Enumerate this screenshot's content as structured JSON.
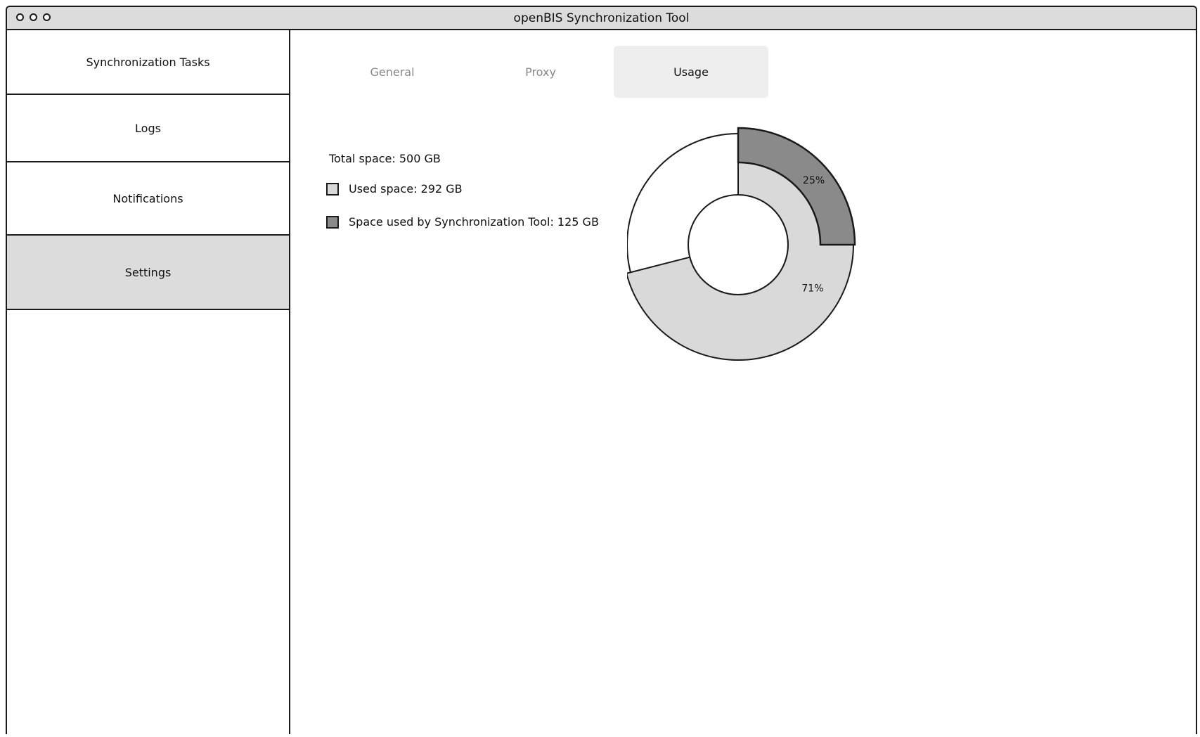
{
  "window": {
    "title": "openBIS Synchronization Tool"
  },
  "sidebar": {
    "items": [
      {
        "label": "Synchronization Tasks",
        "active": false
      },
      {
        "label": "Logs",
        "active": false
      },
      {
        "label": "Notifications",
        "active": false
      },
      {
        "label": "Settings",
        "active": true
      }
    ]
  },
  "tabs": [
    {
      "label": "General",
      "active": false
    },
    {
      "label": "Proxy",
      "active": false
    },
    {
      "label": "Usage",
      "active": true
    }
  ],
  "usage": {
    "total_label": "Total space: 500 GB",
    "used_label": "Used space: 292 GB",
    "tool_label": "Space used by Synchronization Tool: 125 GB"
  },
  "colors": {
    "used": "#d9d9d9",
    "tool": "#8a8a8a",
    "free": "#ffffff",
    "active_bg": "#dcdcdc",
    "stroke": "#1a1a1a"
  },
  "chart_data": {
    "type": "pie",
    "variant": "nested-donut",
    "rings": [
      {
        "name": "Used space",
        "ring": "inner",
        "value_percent": 71,
        "label": "71%",
        "color": "#d9d9d9"
      },
      {
        "name": "Space used by Synchronization Tool",
        "ring": "outer",
        "value_percent": 25,
        "label": "25%",
        "color": "#8a8a8a"
      }
    ],
    "units": "percent of total space",
    "legend_position": "left"
  }
}
